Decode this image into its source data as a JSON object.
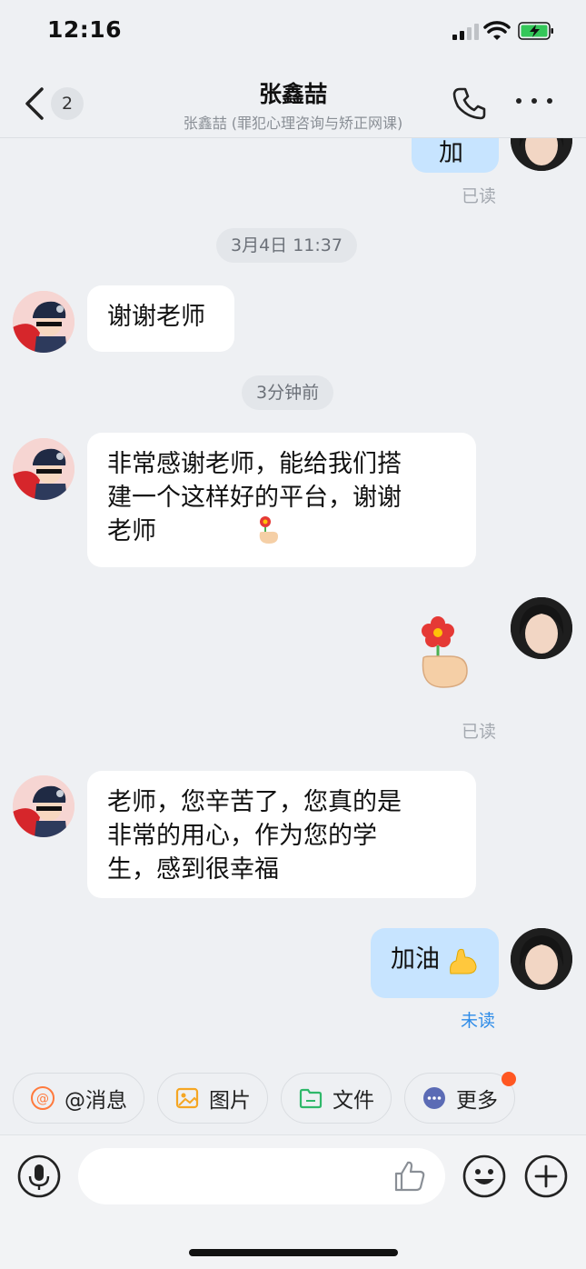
{
  "status_bar": {
    "time": "12:16"
  },
  "nav": {
    "back_count": "2",
    "title": "张鑫喆",
    "subtitle": "张鑫喆 (罪犯心理咨询与矫正网课)"
  },
  "messages": {
    "m0_text": "加",
    "m0_status": "已读",
    "time1": "3月4日 11:37",
    "m1_text": "谢谢老师",
    "time2": "3分钟前",
    "m2_text": "非常感谢老师，能给我们搭\n建一个这样好的平台，谢谢\n老师",
    "m3_status": "已读",
    "m4_text": "老师，您辛苦了，您真的是\n非常的用心，作为您的学\n生，感到很幸福",
    "m5_text": "加油",
    "m5_status": "未读"
  },
  "quick_actions": [
    "@消息",
    "图片",
    "文件",
    "更多"
  ],
  "input": {
    "placeholder": ""
  },
  "colors": {
    "accent": "#2e8ce8",
    "my_bubble": "#c7e4ff",
    "badge": "#ff5722"
  }
}
